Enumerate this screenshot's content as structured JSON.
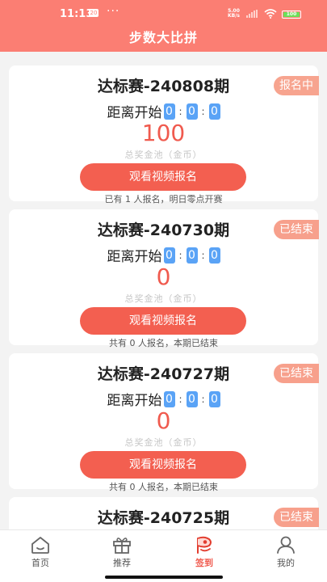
{
  "status_bar": {
    "time": "11:13",
    "notification_badge": "20",
    "network_speed": "5.00\nKB/s",
    "battery": "100"
  },
  "header": {
    "title": "步数大比拼"
  },
  "countdown_label": "距离开始",
  "countdown_digits": [
    "0",
    "0",
    "0"
  ],
  "countdown_separator": ":",
  "pool_label": "总奖金池（金币）",
  "watch_button_label": "观看视频报名",
  "competitions": [
    {
      "title": "达标赛-240808期",
      "status": "报名中",
      "pool": "100",
      "note": "已有 1 人报名，明日零点开赛"
    },
    {
      "title": "达标赛-240730期",
      "status": "已结束",
      "pool": "0",
      "note": "共有 0 人报名，本期已结束"
    },
    {
      "title": "达标赛-240727期",
      "status": "已结束",
      "pool": "0",
      "note": "共有 0 人报名，本期已结束"
    },
    {
      "title": "达标赛-240725期",
      "status": "已结束"
    }
  ],
  "tabs": [
    {
      "label": "首页",
      "icon": "home-icon"
    },
    {
      "label": "推荐",
      "icon": "gift-icon"
    },
    {
      "label": "签到",
      "icon": "checkin-icon",
      "active": true
    },
    {
      "label": "我的",
      "icon": "user-icon"
    }
  ],
  "colors": {
    "header": "#fb7e73",
    "accent": "#f35f50",
    "countdown_box": "#5aa3f6",
    "badge": "#f7a48f"
  }
}
